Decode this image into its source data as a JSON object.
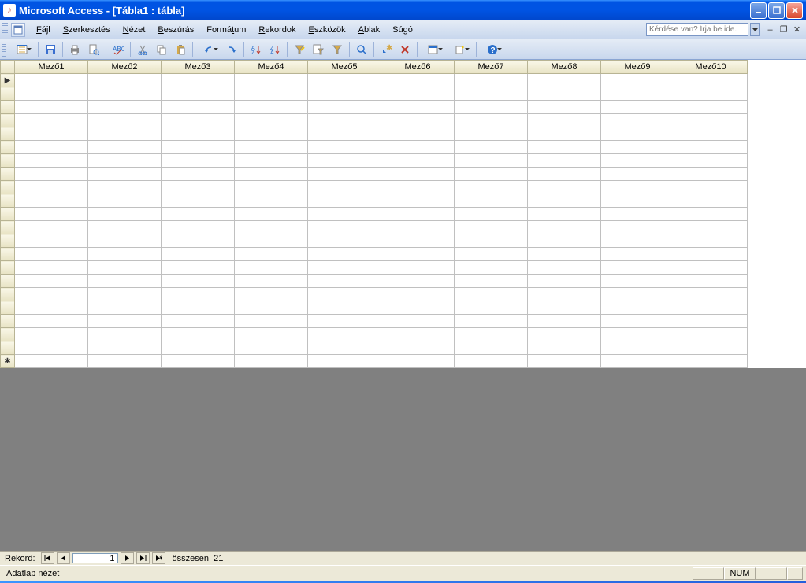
{
  "title": "Microsoft Access - [Tábla1 : tábla]",
  "menu": {
    "fajl": "Fájl",
    "szerkesztes": "Szerkesztés",
    "nezet": "Nézet",
    "beszuras": "Beszúrás",
    "formatum": "Formátum",
    "rekordok": "Rekordok",
    "eszkozok": "Eszközök",
    "ablak": "Ablak",
    "sugo": "Súgó"
  },
  "help_placeholder": "Kérdése van? Írja be ide.",
  "columns": [
    "Mező1",
    "Mező2",
    "Mező3",
    "Mező4",
    "Mező5",
    "Mező6",
    "Mező7",
    "Mező8",
    "Mező9",
    "Mező10"
  ],
  "record_nav": {
    "label": "Rekord:",
    "current": "1",
    "total_label": "összesen",
    "total": "21"
  },
  "status": {
    "mode": "Adatlap nézet",
    "num": "NUM"
  }
}
